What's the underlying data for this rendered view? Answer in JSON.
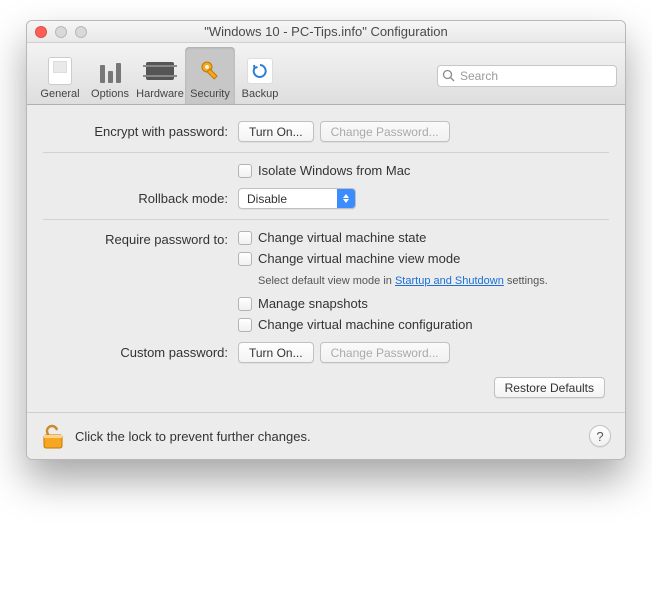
{
  "window": {
    "title": "\"Windows 10 - PC-Tips.info\" Configuration"
  },
  "toolbar": {
    "items": [
      {
        "label": "General"
      },
      {
        "label": "Options"
      },
      {
        "label": "Hardware"
      },
      {
        "label": "Security"
      },
      {
        "label": "Backup"
      }
    ],
    "selected_index": 3
  },
  "search": {
    "placeholder": "Search"
  },
  "security": {
    "encrypt_label": "Encrypt with password:",
    "turn_on_label": "Turn On...",
    "change_password_label": "Change Password...",
    "isolate_label": "Isolate Windows from Mac",
    "rollback_label": "Rollback mode:",
    "rollback_value": "Disable",
    "require_label": "Require password to:",
    "req_items": [
      "Change virtual machine state",
      "Change virtual machine view mode",
      "Manage snapshots",
      "Change virtual machine configuration"
    ],
    "view_mode_hint_prefix": "Select default view mode in ",
    "view_mode_hint_link": "Startup and Shutdown",
    "view_mode_hint_suffix": " settings.",
    "custom_password_label": "Custom password:",
    "restore_defaults_label": "Restore Defaults"
  },
  "footer": {
    "lock_text": "Click the lock to prevent further changes.",
    "help_label": "?"
  }
}
